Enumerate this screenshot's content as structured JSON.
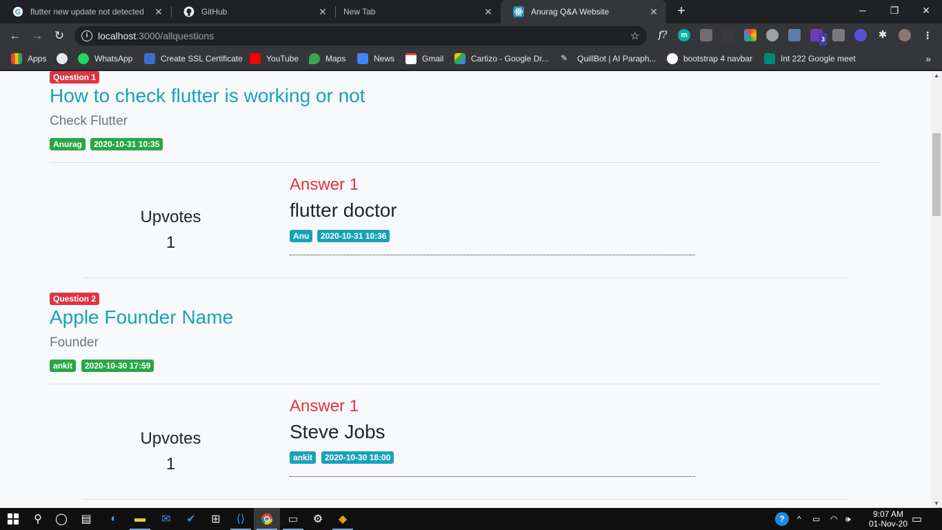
{
  "browser": {
    "tabs": [
      {
        "title": "flutter new update not detected",
        "active": false
      },
      {
        "title": "GitHub",
        "active": false
      },
      {
        "title": "New Tab",
        "active": false
      },
      {
        "title": "Anurag Q&A Website",
        "active": true
      }
    ],
    "url_host": "localhost",
    "url_path": ":3000/allquestions",
    "extensions": [
      "f?",
      "m",
      "3"
    ],
    "bookmarks": [
      "Apps",
      "WhatsApp",
      "Create SSL Certificate",
      "YouTube",
      "Maps",
      "News",
      "Gmail",
      "Cartizo - Google Dr...",
      "QuillBot | AI Paraph...",
      "bootstrap 4 navbar",
      "Int 222 Google meet"
    ]
  },
  "questions": [
    {
      "badge": "Question 1",
      "title": "How to check flutter is working or not",
      "description": "Check Flutter",
      "author": "Anurag",
      "date": "2020-10-31 10:35",
      "answers": [
        {
          "upvotes_label": "Upvotes",
          "upvotes": "1",
          "title": "Answer 1",
          "text": "flutter doctor",
          "author": "Anu",
          "date": "2020-10-31 10:36"
        }
      ]
    },
    {
      "badge": "Question 2",
      "title": "Apple Founder Name",
      "description": "Founder",
      "author": "ankit",
      "date": "2020-10-30 17:59",
      "answers": [
        {
          "upvotes_label": "Upvotes",
          "upvotes": "1",
          "title": "Answer 1",
          "text": "Steve Jobs",
          "author": "ankit",
          "date": "2020-10-30 18:00"
        }
      ]
    }
  ],
  "taskbar": {
    "time": "9:07 AM",
    "date": "01-Nov-20"
  },
  "colors": {
    "question_badge": "#dc3545",
    "question_title": "#17a2b8",
    "meta_badge": "#28a745",
    "answer_badge": "#17a2b8",
    "answer_title": "#dc3545"
  }
}
